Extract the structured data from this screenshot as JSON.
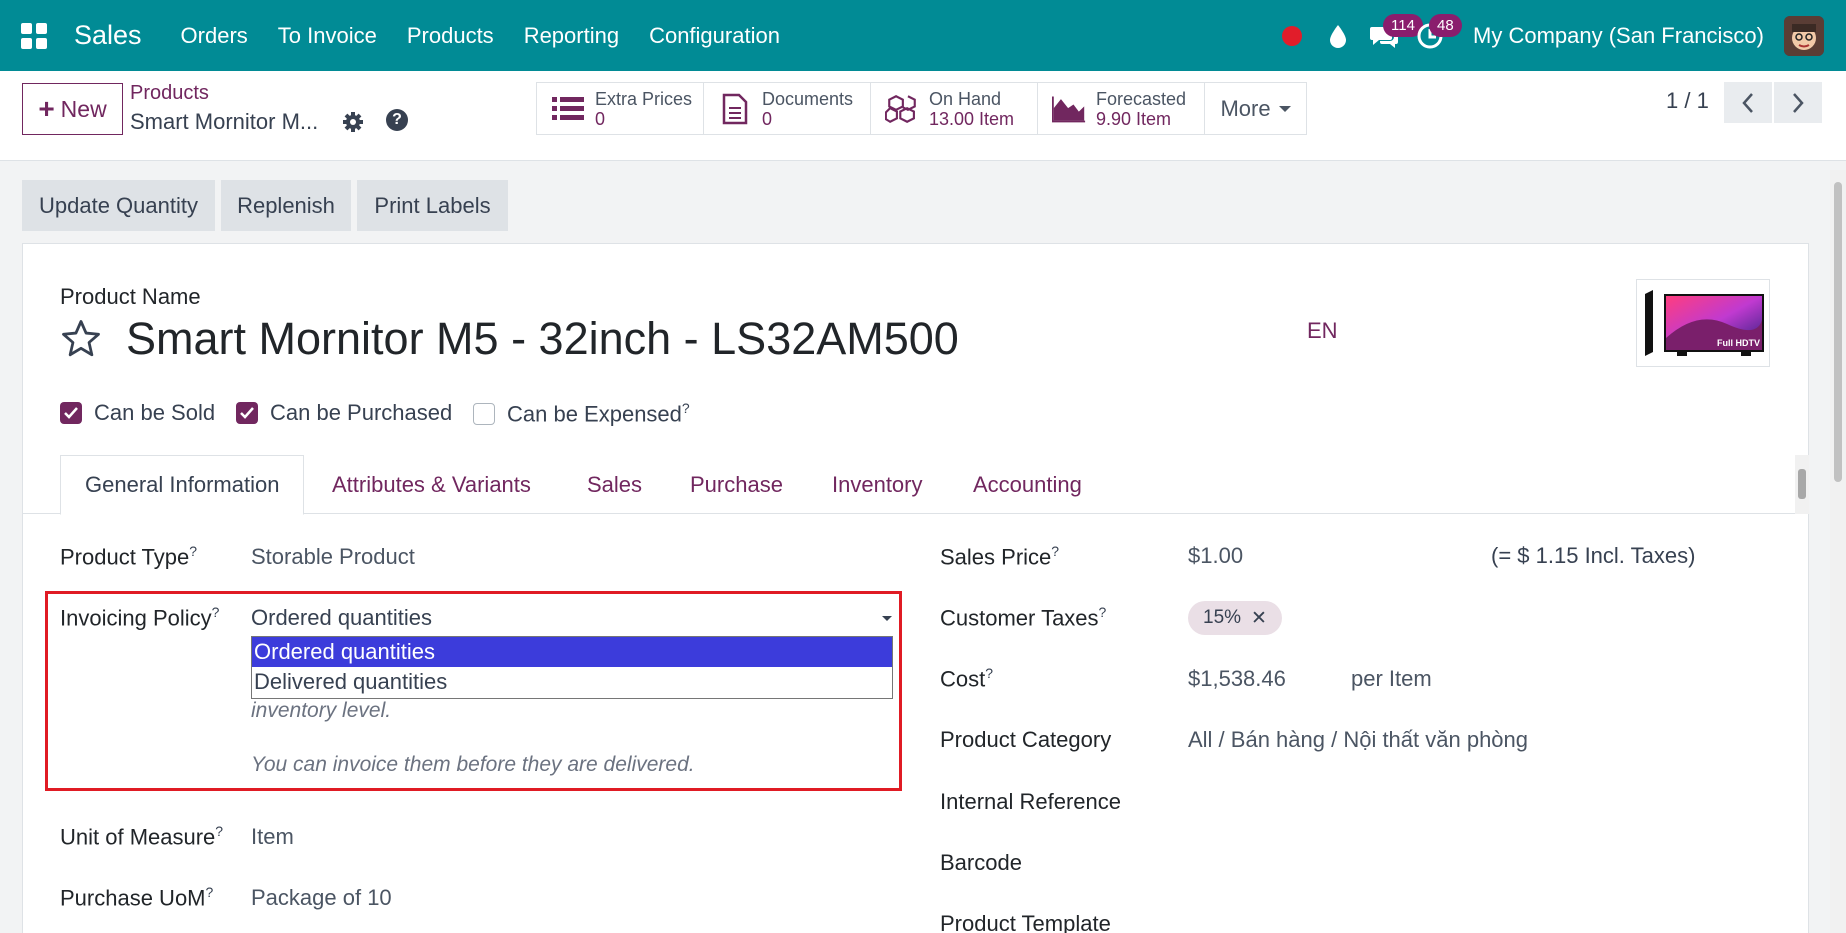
{
  "navbar": {
    "app_name": "Sales",
    "menu": [
      "Orders",
      "To Invoice",
      "Products",
      "Reporting",
      "Configuration"
    ],
    "messages_count": "114",
    "activities_count": "48",
    "company": "My Company (San Francisco)"
  },
  "control_panel": {
    "new_label": "New",
    "breadcrumb_parent": "Products",
    "breadcrumb_current": "Smart Mornitor M...",
    "smart_buttons": [
      {
        "label": "Extra Prices",
        "value": "0",
        "icon": "list-icon"
      },
      {
        "label": "Documents",
        "value": "0",
        "icon": "document-icon"
      },
      {
        "label": "On Hand",
        "value": "13.00 Item",
        "icon": "cubes-icon"
      },
      {
        "label": "Forecasted",
        "value": "9.90 Item",
        "icon": "area-chart-icon"
      }
    ],
    "more_label": "More",
    "pager": "1 / 1"
  },
  "status_buttons": [
    "Update Quantity",
    "Replenish",
    "Print Labels"
  ],
  "form": {
    "product_name_label": "Product Name",
    "product_name": "Smart Mornitor M5 - 32inch - LS32AM500",
    "lang": "EN",
    "image_label": "Full HDTV",
    "checkboxes": [
      {
        "label": "Can be Sold",
        "checked": true
      },
      {
        "label": "Can be Purchased",
        "checked": true
      },
      {
        "label": "Can be Expensed",
        "checked": false
      }
    ],
    "tabs": [
      "General Information",
      "Attributes & Variants",
      "Sales",
      "Purchase",
      "Inventory",
      "Accounting"
    ],
    "left_fields": {
      "product_type_label": "Product Type",
      "product_type": "Storable Product",
      "invoicing_policy_label": "Invoicing Policy",
      "invoicing_policy": "Ordered quantities",
      "invoicing_options": [
        "Ordered quantities",
        "Delivered quantities"
      ],
      "help_line1": "inventory level.",
      "help_line2": "You can invoice them before they are delivered.",
      "uom_label": "Unit of Measure",
      "uom": "Item",
      "purchase_uom_label": "Purchase UoM",
      "purchase_uom": "Package of 10"
    },
    "right_fields": {
      "sales_price_label": "Sales Price",
      "sales_price": "$1.00",
      "incl_taxes": "(= $ 1.15 Incl. Taxes)",
      "customer_taxes_label": "Customer Taxes",
      "customer_tax_tag": "15%",
      "cost_label": "Cost",
      "cost": "$1,538.46",
      "cost_unit": "per Item",
      "category_label": "Product Category",
      "category": "All / Bán hàng / Nội thất văn phòng",
      "internal_ref_label": "Internal Reference",
      "barcode_label": "Barcode",
      "template_label": "Product Template"
    }
  },
  "colors": {
    "navbar": "#018b95",
    "primary": "#71275f",
    "highlight": "#e01b24",
    "selected_option": "#3c3cdb"
  }
}
